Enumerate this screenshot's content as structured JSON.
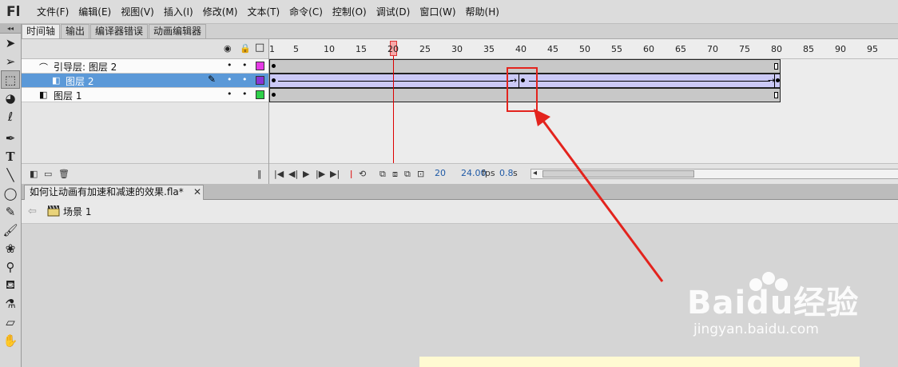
{
  "app": {
    "logo": "Fl"
  },
  "menu": [
    "文件(F)",
    "编辑(E)",
    "视图(V)",
    "插入(I)",
    "修改(M)",
    "文本(T)",
    "命令(C)",
    "控制(O)",
    "调试(D)",
    "窗口(W)",
    "帮助(H)"
  ],
  "panel_tabs": [
    "时间轴",
    "输出",
    "编译器错误",
    "动画编辑器"
  ],
  "layers": [
    {
      "name": "引导层: 图层 2",
      "color": "#e63ce6"
    },
    {
      "name": "图层 2",
      "color": "#8a34d6"
    },
    {
      "name": "图层 1",
      "color": "#2fd04a"
    }
  ],
  "ruler": {
    "numbers": [
      "1",
      "5",
      "10",
      "15",
      "20",
      "25",
      "30",
      "35",
      "40",
      "45",
      "50",
      "55",
      "60",
      "65",
      "70",
      "75",
      "80",
      "85",
      "90",
      "95"
    ]
  },
  "timeline": {
    "current_frame": "20",
    "fps_value": "24.00",
    "fps_unit": "fps",
    "time_value": "0.8",
    "time_unit": "s"
  },
  "document": {
    "tab_title": "如何让动画有加速和减速的效果.fla*",
    "tab_close": "✕",
    "scene_label": "场景 1"
  },
  "watermark": {
    "brand": "Baidu经验",
    "url": "jingyan.baidu.com"
  },
  "colors": {
    "selected_layer": "#5b99d8",
    "tween_selected": "#cbc9f6",
    "annotation": "#e3231d"
  }
}
